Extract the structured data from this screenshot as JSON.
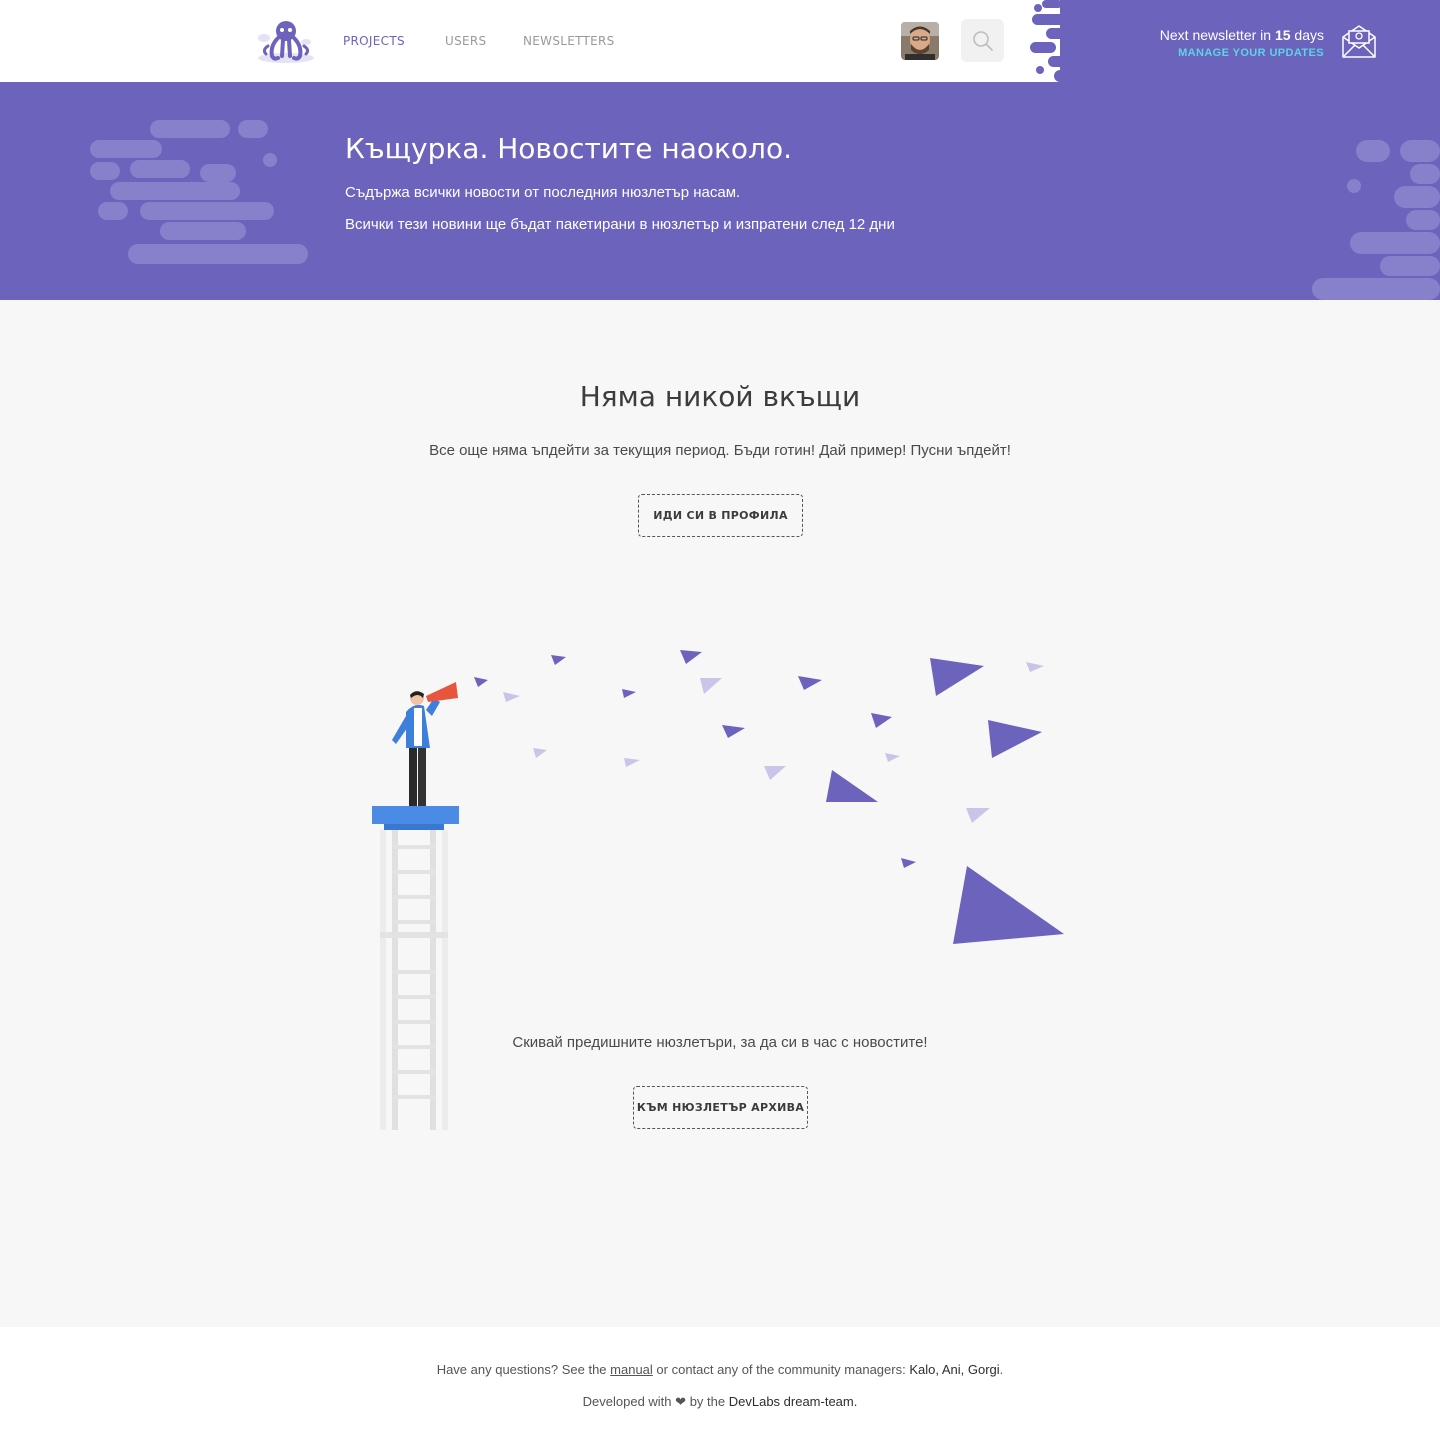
{
  "nav": {
    "items": [
      {
        "label": "PROJECTS",
        "active": true
      },
      {
        "label": "USERS",
        "active": false
      },
      {
        "label": "NEWSLETTERS",
        "active": false
      }
    ]
  },
  "newsletter": {
    "prefix": "Next newsletter in",
    "days": "15",
    "suffix": "days",
    "manage_label": "MANAGE YOUR UPDATES"
  },
  "hero": {
    "title": "Къщурка. Новостите наоколо.",
    "line1": "Съдържа всички новости от последния нюзлетър насам.",
    "line2": "Всички тези новини ще бъдат пакетирани в нюзлетър и изпратени след 12 дни"
  },
  "empty": {
    "title": "Няма никой вкъщи",
    "text": "Все още няма ъпдейти за текущия период. Бъди готин! Дай пример! Пусни ъпдейт!",
    "profile_button": "ИДИ СИ В ПРОФИЛА"
  },
  "archive": {
    "text": "Скивай предишните нюзлетъри, за да си в час с новостите!",
    "button": "КЪМ НЮЗЛЕТЪР АРХИВА"
  },
  "footer": {
    "q_prefix": "Have any questions? See the",
    "manual_link": "manual",
    "q_middle": "or contact any of the community managers:",
    "managers": "Kalo, Ani, Gorgi",
    "q_end": ".",
    "dev_prefix": "Developed with",
    "heart": "❤",
    "dev_middle": "by the",
    "team": "DevLabs dream-team."
  },
  "colors": {
    "brand": "#6b63bc",
    "accent": "#5fd3e6",
    "background": "#f7f7f7"
  },
  "icons": [
    "octopus-logo-icon",
    "search-icon",
    "mail-icon",
    "heart-icon"
  ]
}
